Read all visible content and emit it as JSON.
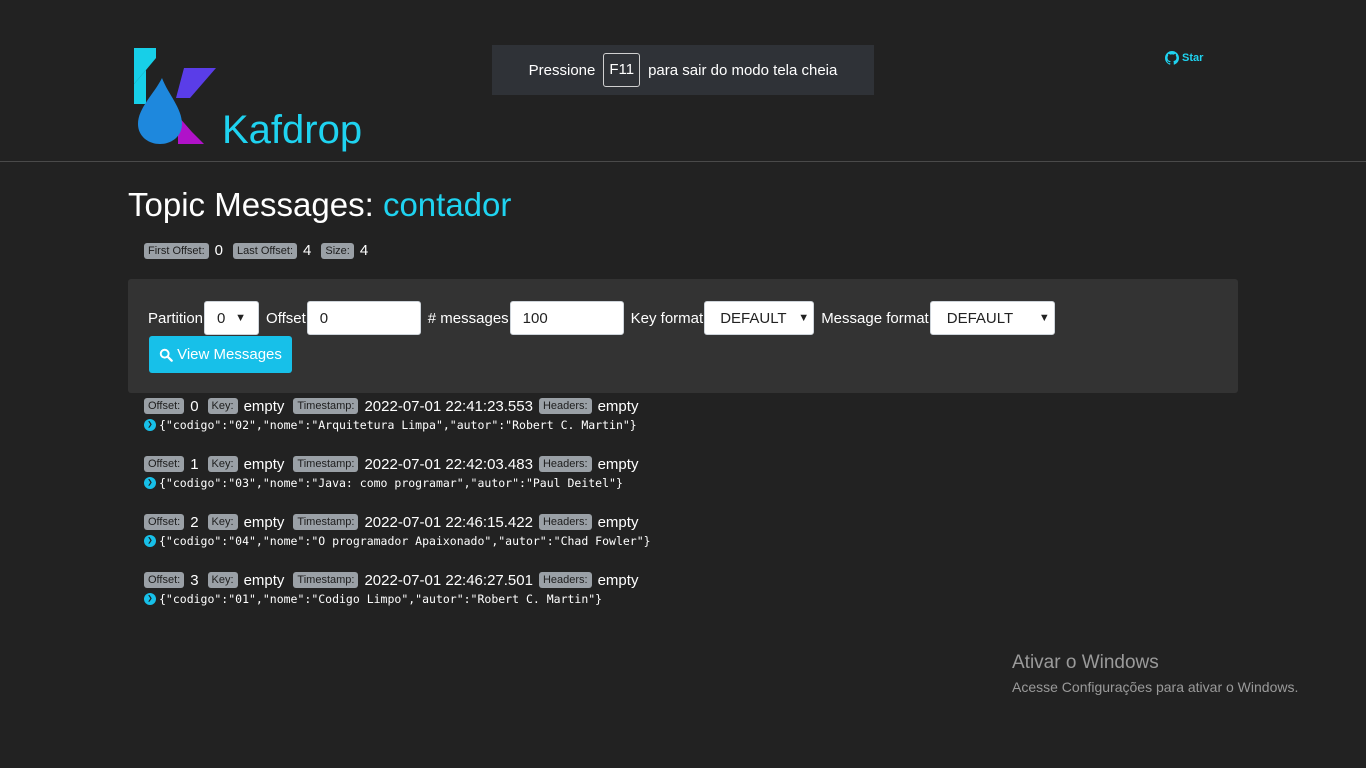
{
  "header": {
    "brand": "Kafdrop",
    "star_label": "Star"
  },
  "fullscreen_notice": {
    "prefix": "Pressione",
    "key": "F11",
    "suffix": "para sair do modo tela cheia"
  },
  "title": {
    "prefix": "Topic Messages:",
    "topic": "contador"
  },
  "stats": {
    "first_offset_label": "First Offset:",
    "first_offset": "0",
    "last_offset_label": "Last Offset:",
    "last_offset": "4",
    "size_label": "Size:",
    "size": "4"
  },
  "form": {
    "partition_label": "Partition",
    "partition_value": "0",
    "offset_label": "Offset",
    "offset_value": "0",
    "messages_label": "# messages",
    "messages_value": "100",
    "key_format_label": "Key format",
    "key_format_value": "DEFAULT",
    "message_format_label": "Message format",
    "message_format_value": "DEFAULT",
    "view_button": "View Messages"
  },
  "labels": {
    "offset": "Offset:",
    "key": "Key:",
    "timestamp": "Timestamp:",
    "headers": "Headers:"
  },
  "messages": [
    {
      "offset": "0",
      "key": "empty",
      "timestamp": "2022-07-01 22:41:23.553",
      "headers": "empty",
      "body": "{\"codigo\":\"02\",\"nome\":\"Arquitetura Limpa\",\"autor\":\"Robert C. Martin\"}"
    },
    {
      "offset": "1",
      "key": "empty",
      "timestamp": "2022-07-01 22:42:03.483",
      "headers": "empty",
      "body": "{\"codigo\":\"03\",\"nome\":\"Java: como programar\",\"autor\":\"Paul Deitel\"}"
    },
    {
      "offset": "2",
      "key": "empty",
      "timestamp": "2022-07-01 22:46:15.422",
      "headers": "empty",
      "body": "{\"codigo\":\"04\",\"nome\":\"O programador Apaixonado\",\"autor\":\"Chad Fowler\"}"
    },
    {
      "offset": "3",
      "key": "empty",
      "timestamp": "2022-07-01 22:46:27.501",
      "headers": "empty",
      "body": "{\"codigo\":\"01\",\"nome\":\"Codigo Limpo\",\"autor\":\"Robert C. Martin\"}"
    }
  ],
  "watermark": {
    "title": "Ativar o Windows",
    "subtitle": "Acesse Configurações para ativar o Windows."
  },
  "colors": {
    "background": "#222222",
    "accent": "#1fd3f0",
    "button": "#17c0e9",
    "panel": "#333333"
  }
}
